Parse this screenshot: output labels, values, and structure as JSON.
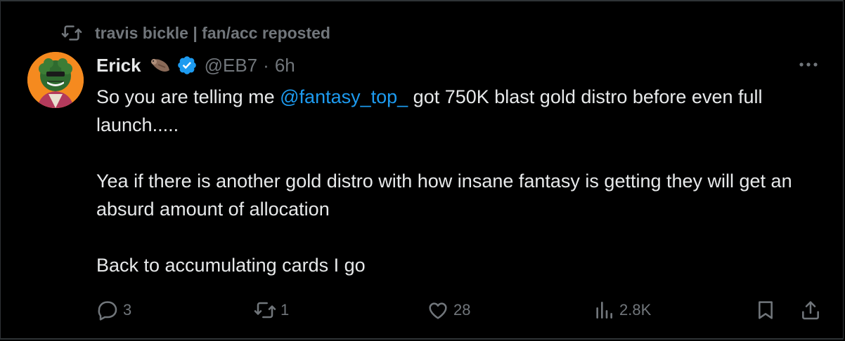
{
  "repost": {
    "text": "travis bickle | fan/acc reposted",
    "icon": "repost-icon"
  },
  "author": {
    "display_name": "Erick",
    "handle": "@EB7",
    "separator": "·",
    "time": "6h",
    "avatar_color": "#f58a1f",
    "verified_color": "#1d9bf0"
  },
  "tweet": {
    "line1_before": "So you are telling me ",
    "mention": "@fantasy_top_",
    "line1_after": " got 750K blast gold distro before even full launch.....",
    "para2": "Yea if there is another gold distro with how insane fantasy is getting they will get an absurd amount of allocation",
    "para3": "Back to accumulating cards I go"
  },
  "actions": {
    "replies": "3",
    "reposts": "1",
    "likes": "28",
    "views": "2.8K"
  },
  "colors": {
    "background": "#000000",
    "text": "#e7e9ea",
    "muted": "#71767b",
    "accent": "#1d9bf0",
    "border": "#2f3336"
  }
}
